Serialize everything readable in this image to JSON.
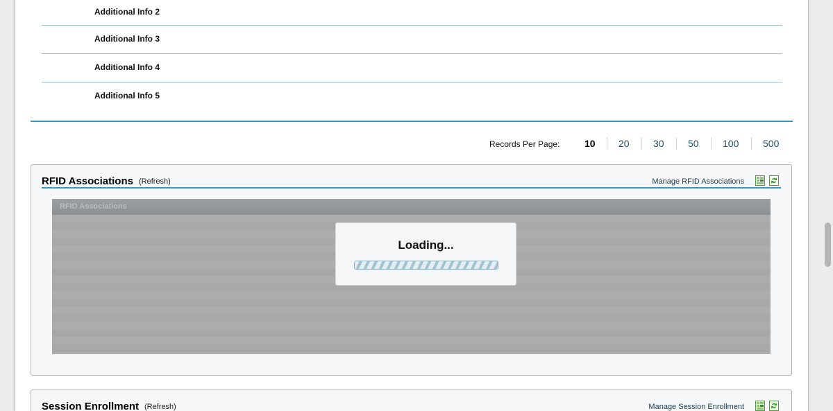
{
  "additional_info": [
    {
      "label": "Additional Info 2"
    },
    {
      "label": "Additional Info 3"
    },
    {
      "label": "Additional Info 4"
    },
    {
      "label": "Additional Info 5"
    }
  ],
  "pagination": {
    "label": "Records Per Page:",
    "options": [
      "10",
      "20",
      "30",
      "50",
      "100",
      "500"
    ],
    "selected": "10"
  },
  "rfid_panel": {
    "title": "RFID Associations",
    "refresh_label": "(Refresh)",
    "manage_label": "Manage RFID Associations",
    "grid_header": "RFID Associations",
    "loading_text": "Loading...",
    "icons": [
      "export-excel-icon",
      "refresh-icon"
    ]
  },
  "session_panel": {
    "title": "Session Enrollment",
    "refresh_label": "(Refresh)",
    "manage_label": "Manage Session Enrollment",
    "icons": [
      "export-excel-icon",
      "refresh-icon"
    ]
  },
  "colors": {
    "accent_blue": "#2b9ac9",
    "overlay_gray": "#ababab"
  }
}
